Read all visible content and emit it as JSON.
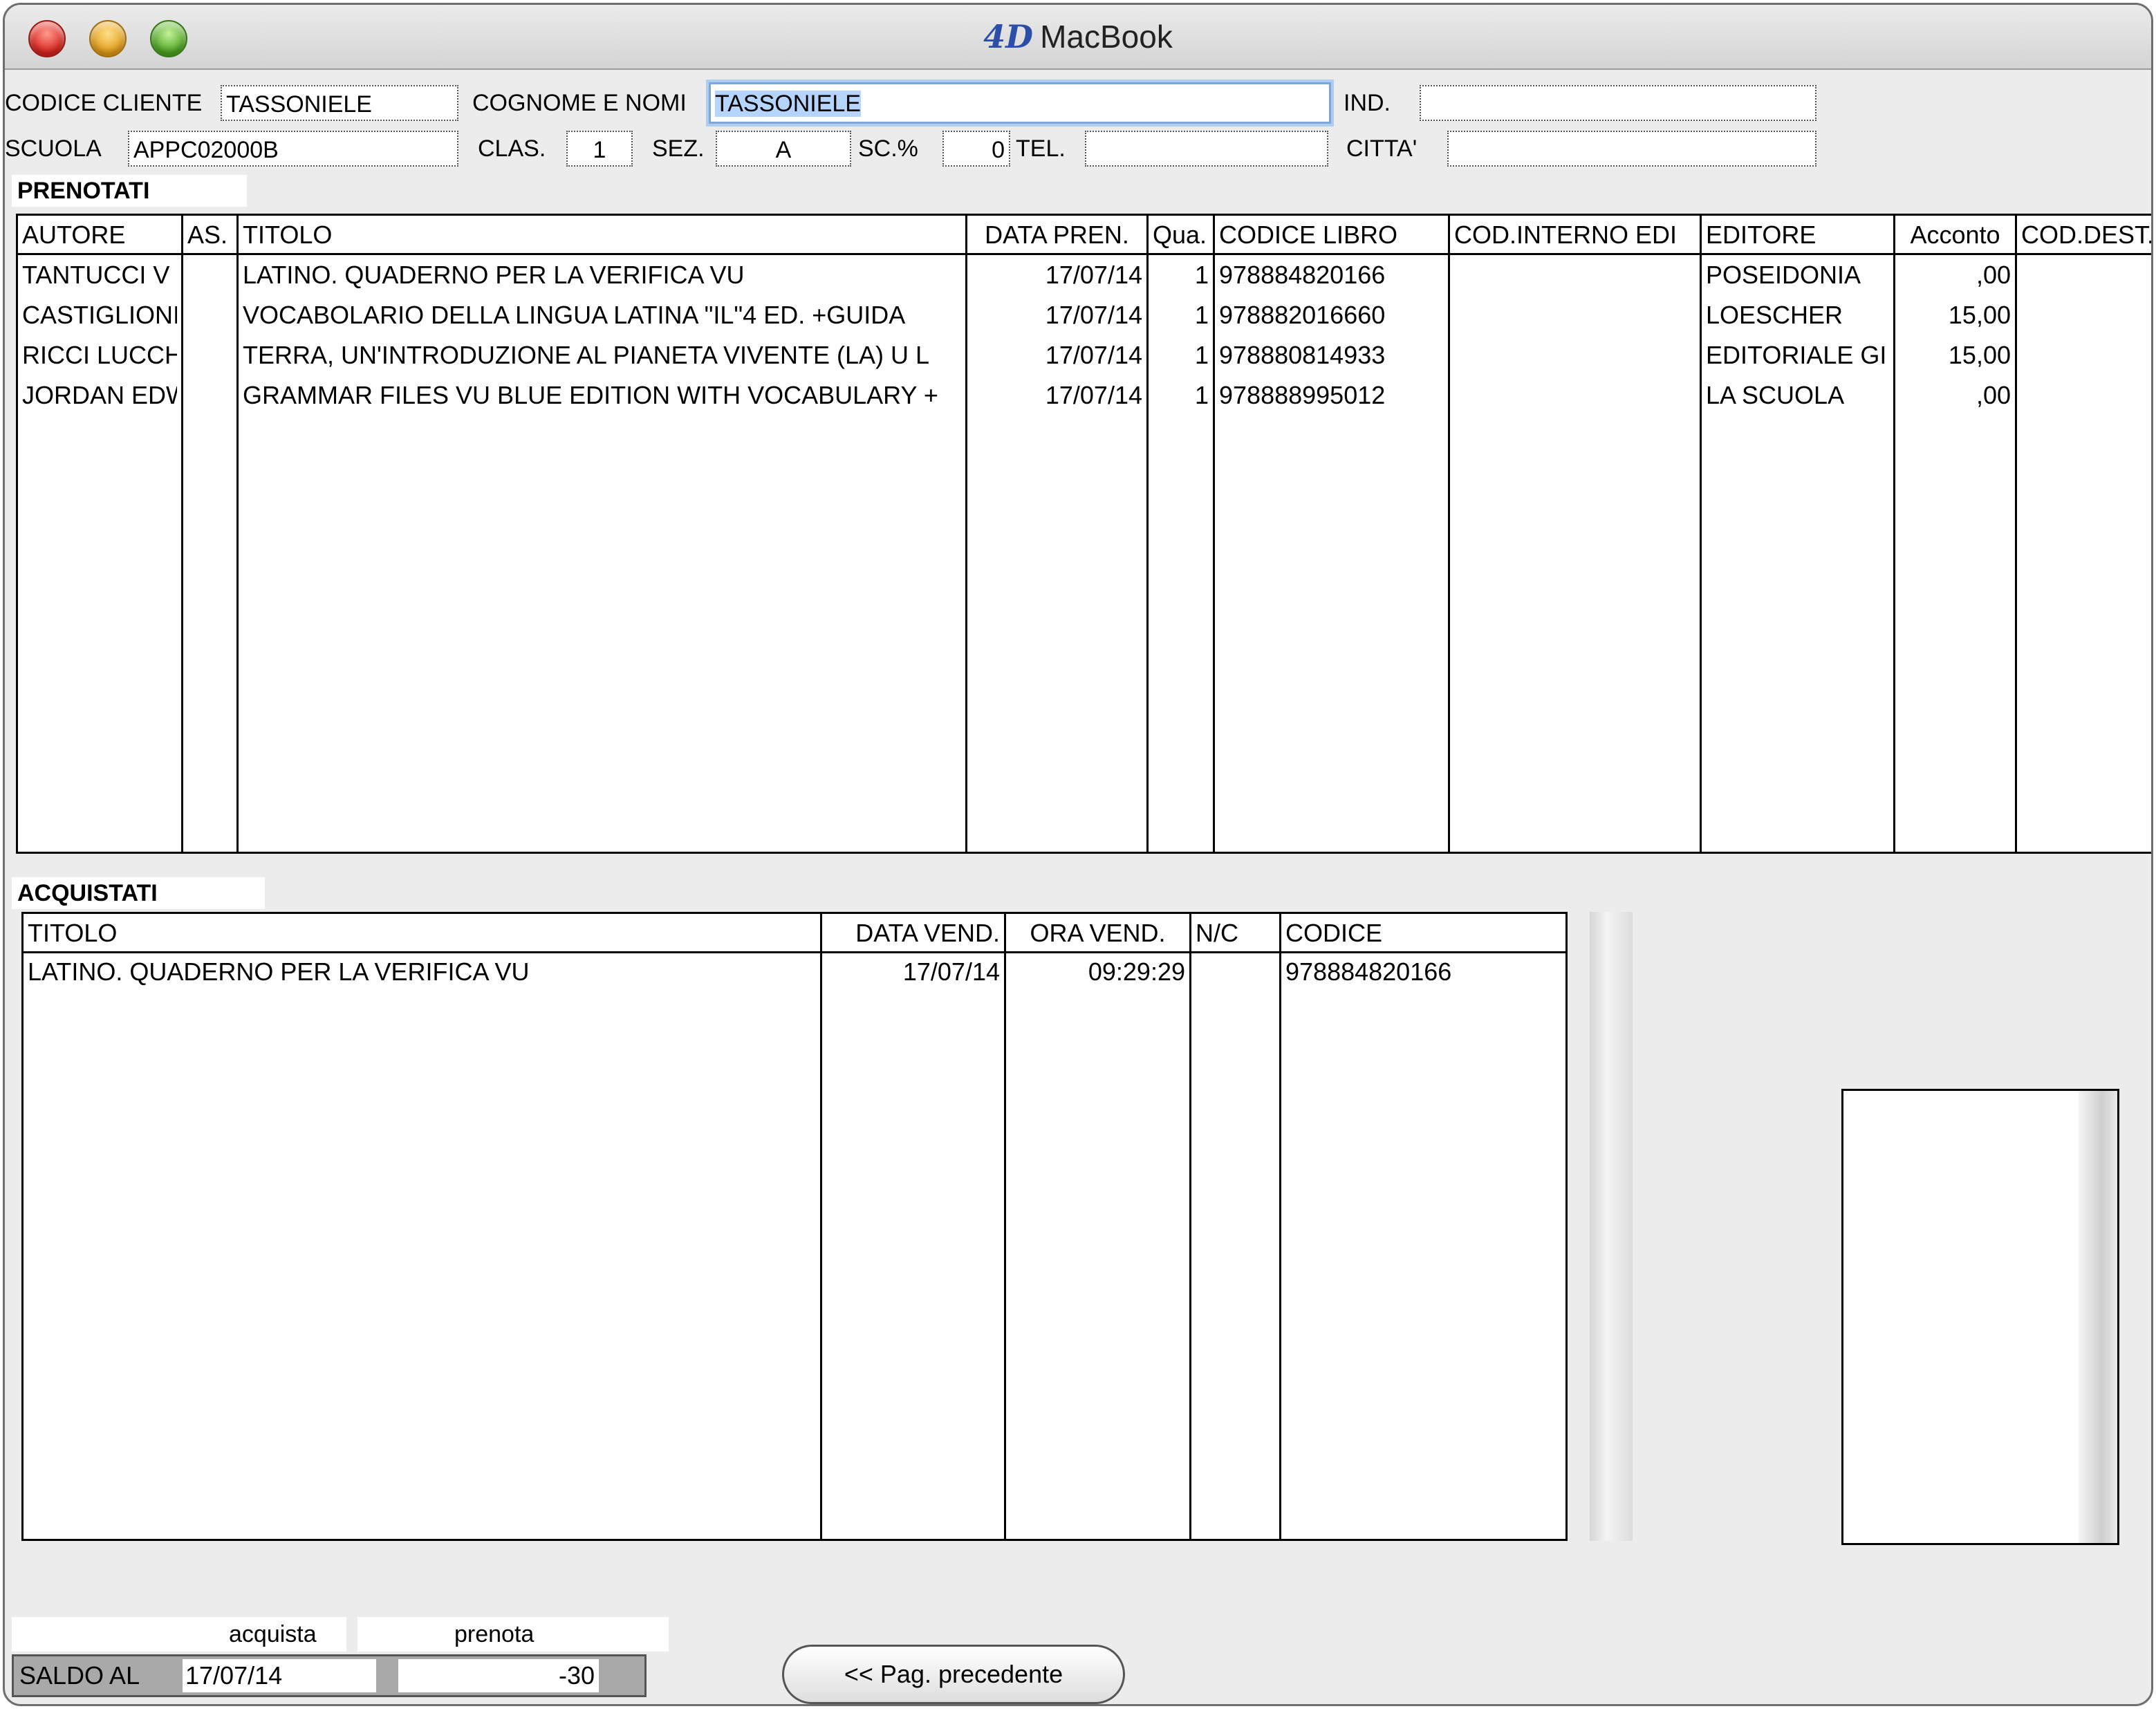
{
  "window": {
    "title": "MacBook",
    "logo": "4D"
  },
  "header": {
    "codice_cliente": {
      "label": "CODICE CLIENTE",
      "value": "TASSONIELE"
    },
    "cognome_nome": {
      "label": "COGNOME E NOMI",
      "value": "TASSONIELE"
    },
    "ind": {
      "label": "IND.",
      "value": ""
    },
    "scuola": {
      "label": "SCUOLA",
      "value": "APPC02000B"
    },
    "clas": {
      "label": "CLAS.",
      "value": "1"
    },
    "sez": {
      "label": "SEZ.",
      "value": "A"
    },
    "sc": {
      "label": "SC.%",
      "value": "0"
    },
    "tel": {
      "label": "TEL.",
      "value": ""
    },
    "citta": {
      "label": "CITTA'",
      "value": ""
    }
  },
  "prenotati": {
    "title": "PRENOTATI",
    "columns": [
      "AUTORE",
      "AS.",
      "TITOLO",
      "DATA PREN.",
      "Qua.",
      "CODICE LIBRO",
      "COD.INTERNO EDI",
      "EDITORE",
      "Acconto",
      "COD.DEST."
    ],
    "rows": [
      [
        "TANTUCCI V",
        "",
        "LATINO. QUADERNO PER LA VERIFICA VU",
        "17/07/14",
        "1",
        "978884820166",
        "",
        "POSEIDONIA",
        ",00",
        ""
      ],
      [
        "CASTIGLIONI",
        "",
        "VOCABOLARIO DELLA LINGUA LATINA \"IL\"4 ED. +GUIDA",
        "17/07/14",
        "1",
        "978882016660",
        "",
        "LOESCHER",
        "15,00",
        ""
      ],
      [
        "RICCI LUCCH",
        "",
        "TERRA, UN'INTRODUZIONE AL PIANETA VIVENTE (LA) U L",
        "17/07/14",
        "1",
        "978880814933",
        "",
        "EDITORIALE GI",
        "15,00",
        ""
      ],
      [
        "JORDAN EDW",
        "",
        "GRAMMAR FILES VU BLUE EDITION  WITH VOCABULARY +",
        "17/07/14",
        "1",
        "978888995012",
        "",
        "LA SCUOLA",
        ",00",
        ""
      ]
    ]
  },
  "acquistati": {
    "title": "ACQUISTATI",
    "columns": [
      "TITOLO",
      "DATA VEND.",
      "ORA VEND.",
      "N/C",
      "CODICE"
    ],
    "rows": [
      [
        "LATINO. QUADERNO PER LA VERIFICA VU",
        "17/07/14",
        "09:29:29",
        "",
        "978884820166"
      ]
    ]
  },
  "footer": {
    "acquista_label": "acquista",
    "prenota_label": "prenota",
    "saldo_label": "SALDO AL",
    "saldo_date": "17/07/14",
    "saldo_value": "-30",
    "prev_button": "<< Pag. precedente"
  }
}
